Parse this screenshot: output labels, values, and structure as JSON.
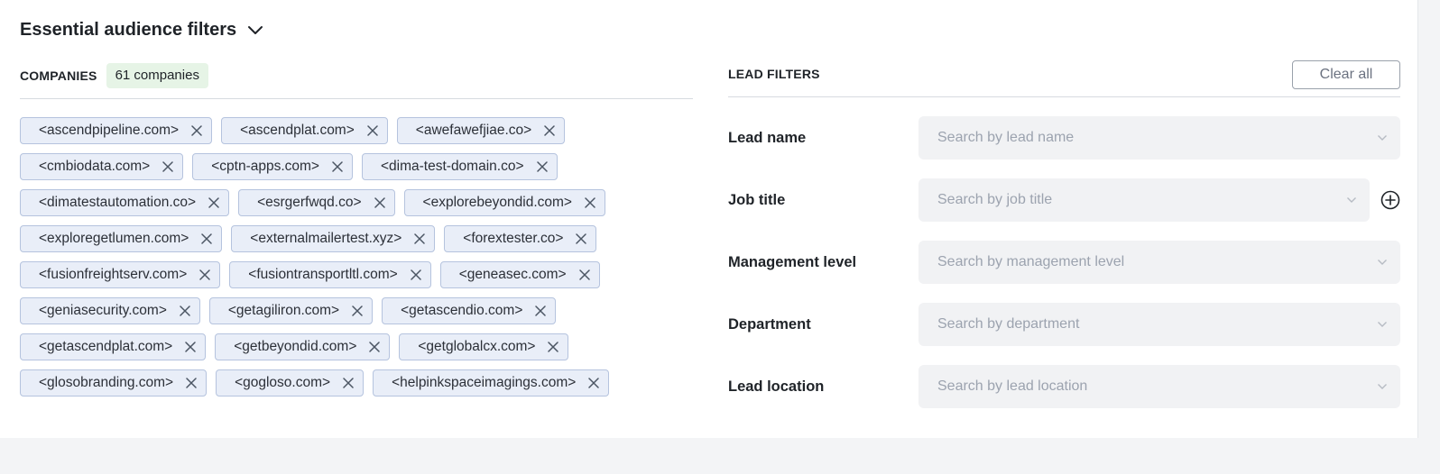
{
  "header": {
    "title": "Essential audience filters",
    "icon": "chevron-down-icon"
  },
  "companies": {
    "label": "COMPANIES",
    "count_badge": "61 companies",
    "items": [
      "<ascendpipeline.com>",
      "<ascendplat.com>",
      "<awefawefjiae.co>",
      "<cmbiodata.com>",
      "<cptn-apps.com>",
      "<dima-test-domain.co>",
      "<dimatestautomation.co>",
      "<esrgerfwqd.co>",
      "<explorebeyondid.com>",
      "<exploregetlumen.com>",
      "<externalmailertest.xyz>",
      "<forextester.co>",
      "<fusionfreightserv.com>",
      "<fusiontransportltl.com>",
      "<geneasec.com>",
      "<geniasecurity.com>",
      "<getagiliron.com>",
      "<getascendio.com>",
      "<getascendplat.com>",
      "<getbeyondid.com>",
      "<getglobalcx.com>",
      "<glosobranding.com>",
      "<gogloso.com>",
      "<helpinkspaceimagings.com>"
    ]
  },
  "lead_filters": {
    "label": "LEAD FILTERS",
    "clear_all": "Clear all",
    "filters": [
      {
        "label": "Lead name",
        "placeholder": "Search by lead name"
      },
      {
        "label": "Job title",
        "placeholder": "Search by job title"
      },
      {
        "label": "Management level",
        "placeholder": "Search by management level"
      },
      {
        "label": "Department",
        "placeholder": "Search by department"
      },
      {
        "label": "Lead location",
        "placeholder": "Search by lead location"
      }
    ]
  },
  "colors": {
    "chip_bg": "#e9eef8",
    "chip_border": "#b5c3de",
    "badge_bg": "#e6f4e6",
    "select_bg": "#f1f2f4",
    "placeholder": "#9ca3af"
  }
}
